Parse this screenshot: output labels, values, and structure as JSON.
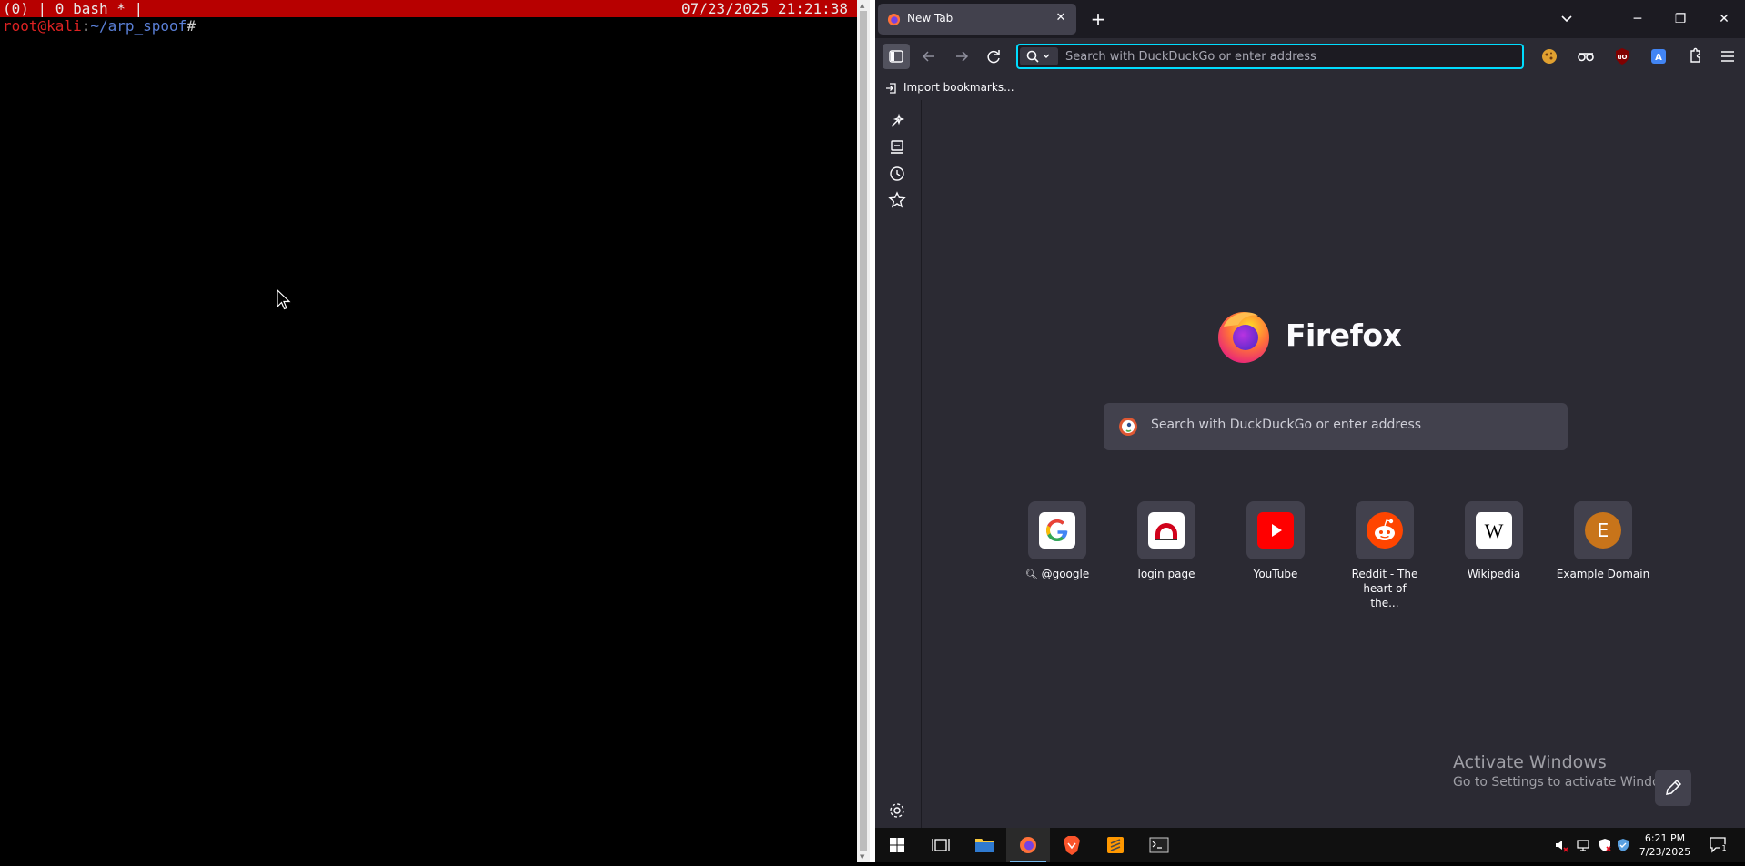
{
  "terminal": {
    "status_left": "(0) | 0 bash * |",
    "status_right": "07/23/2025 21:21:38",
    "prompt_user": "root@kali",
    "prompt_colon": ":",
    "prompt_path": "~/arp_spoof",
    "prompt_hash": "#"
  },
  "browser": {
    "tab_title": "New Tab",
    "urlbar_placeholder": "Search with DuckDuckGo or enter address",
    "import_bookmarks": "Import bookmarks...",
    "brand": "Firefox",
    "hero_search_placeholder": "Search with DuckDuckGo or enter address",
    "top_sites": [
      {
        "label": "@google",
        "icon": "google-icon"
      },
      {
        "label": "login page",
        "icon": "login-page-icon"
      },
      {
        "label": "YouTube",
        "icon": "youtube-icon"
      },
      {
        "label": "Reddit - The heart of the...",
        "icon": "reddit-icon"
      },
      {
        "label": "Wikipedia",
        "icon": "wikipedia-icon"
      },
      {
        "label": "Example Domain",
        "icon": "example-domain-icon",
        "letter": "E"
      }
    ],
    "watermark_title": "Activate Windows",
    "watermark_sub": "Go to Settings to activate Windows.",
    "accent_color": "#00ddff"
  },
  "taskbar": {
    "time": "6:21 PM",
    "date": "7/23/2025",
    "notification_count": "1"
  }
}
